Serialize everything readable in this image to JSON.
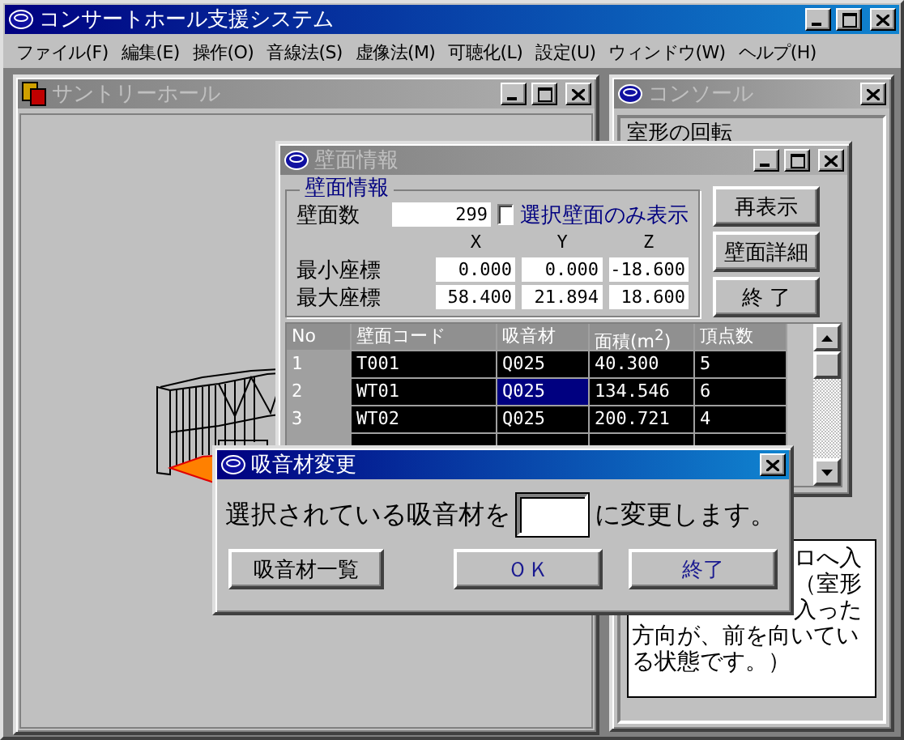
{
  "app": {
    "title": "コンサートホール支援システム",
    "active": true
  },
  "menu": [
    "ファイル(F)",
    "編集(E)",
    "操作(O)",
    "音線法(S)",
    "虚像法(M)",
    "可聴化(L)",
    "設定(U)",
    "ウィンドウ(W)",
    "ヘルプ(H)"
  ],
  "hall_window": {
    "title": "サントリーホール",
    "active": false
  },
  "console_window": {
    "title": "コンソール",
    "active": false,
    "heading": "室形の回転",
    "message_lines": [
      {
        "text": "ロへ入",
        "cut_left": true
      },
      {
        "text": "（室形",
        "cut_left": true
      },
      {
        "text": "入った",
        "cut_left": true
      },
      {
        "text": "方向が、前を向いてい",
        "cut_left": false
      },
      {
        "text": "る状態です。）",
        "cut_left": false
      }
    ]
  },
  "wall_window": {
    "title": "壁面情報",
    "active": false,
    "group_title": "壁面情報",
    "count_label": "壁面数",
    "count": "299",
    "selected_only": {
      "label": "選択壁面のみ表示",
      "checked": false
    },
    "axes": [
      "X",
      "Y",
      "Z"
    ],
    "coordinates": [
      {
        "label": "最小座標",
        "values": [
          "0.000",
          "0.000",
          "-18.600"
        ]
      },
      {
        "label": "最大座標",
        "values": [
          "58.400",
          "21.894",
          "18.600"
        ]
      }
    ],
    "buttons": [
      "再表示",
      "壁面詳細",
      "終 了"
    ],
    "table": {
      "columns": [
        "No",
        "壁面コード",
        "吸音材",
        "面積(m$^{2}$)",
        "頂点数"
      ],
      "rows": [
        {
          "cells": [
            {
              "text": "1",
              "selected": false
            },
            {
              "text": "T001",
              "selected": false
            },
            {
              "text": "Q025",
              "selected": false
            },
            {
              "text": "40.300",
              "selected": false
            },
            {
              "text": "5",
              "selected": false
            }
          ]
        },
        {
          "cells": [
            {
              "text": "2",
              "selected": false
            },
            {
              "text": "WT01",
              "selected": false
            },
            {
              "text": "Q025",
              "selected": true
            },
            {
              "text": "134.546",
              "selected": false
            },
            {
              "text": "6",
              "selected": false
            }
          ]
        },
        {
          "cells": [
            {
              "text": "3",
              "selected": false
            },
            {
              "text": "WT02",
              "selected": false
            },
            {
              "text": "Q025",
              "selected": false
            },
            {
              "text": "200.721",
              "selected": false
            },
            {
              "text": "4",
              "selected": false
            }
          ]
        }
      ]
    }
  },
  "dialog": {
    "title": "吸音材変更",
    "active": true,
    "prompt": "選択されている吸音材を",
    "suffix": "に変更します。",
    "buttons": [
      "吸音材一覧",
      "ＯＫ",
      "終了"
    ]
  }
}
